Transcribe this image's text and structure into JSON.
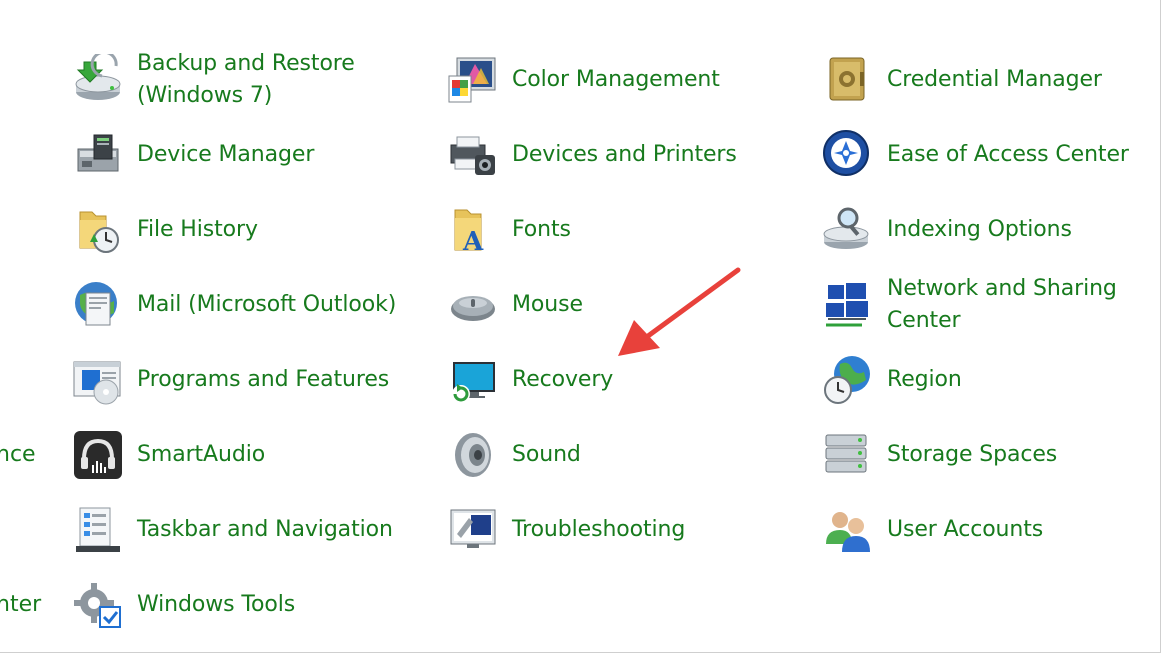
{
  "control_panel": {
    "clipped_left": [
      {
        "text": "nce"
      },
      {
        "text": "nter"
      }
    ],
    "items": [
      {
        "label": "Backup and Restore (Windows 7)",
        "icon": "backup-restore-icon"
      },
      {
        "label": "Color Management",
        "icon": "color-management-icon"
      },
      {
        "label": "Credential Manager",
        "icon": "credential-manager-icon"
      },
      {
        "label": "Device Manager",
        "icon": "device-manager-icon"
      },
      {
        "label": "Devices and Printers",
        "icon": "devices-printers-icon"
      },
      {
        "label": "Ease of Access Center",
        "icon": "ease-of-access-icon"
      },
      {
        "label": "File History",
        "icon": "file-history-icon"
      },
      {
        "label": "Fonts",
        "icon": "fonts-icon"
      },
      {
        "label": "Indexing Options",
        "icon": "indexing-options-icon"
      },
      {
        "label": "Mail (Microsoft Outlook)",
        "icon": "mail-icon"
      },
      {
        "label": "Mouse",
        "icon": "mouse-icon"
      },
      {
        "label": "Network and Sharing Center",
        "icon": "network-sharing-icon"
      },
      {
        "label": "Programs and Features",
        "icon": "programs-features-icon"
      },
      {
        "label": "Recovery",
        "icon": "recovery-icon"
      },
      {
        "label": "Region",
        "icon": "region-icon"
      },
      {
        "label": "SmartAudio",
        "icon": "smartaudio-icon"
      },
      {
        "label": "Sound",
        "icon": "sound-icon"
      },
      {
        "label": "Storage Spaces",
        "icon": "storage-spaces-icon"
      },
      {
        "label": "Taskbar and Navigation",
        "icon": "taskbar-navigation-icon"
      },
      {
        "label": "Troubleshooting",
        "icon": "troubleshooting-icon"
      },
      {
        "label": "User Accounts",
        "icon": "user-accounts-icon"
      },
      {
        "label": "Windows Tools",
        "icon": "windows-tools-icon"
      }
    ]
  },
  "colors": {
    "link_green": "#177a1d",
    "annotation_arrow": "#e8413b"
  }
}
